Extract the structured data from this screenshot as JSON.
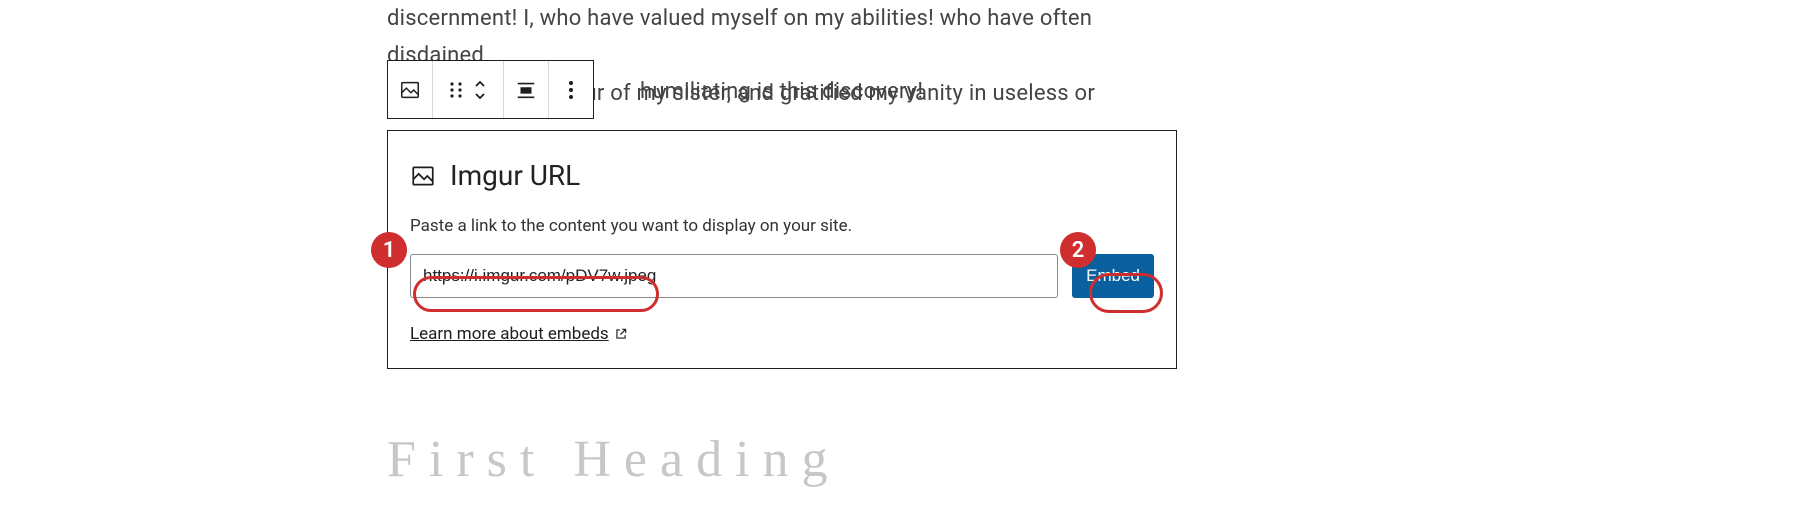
{
  "prose": {
    "line1": "discernment! I, who have valued myself on my abilities! who have often disdained",
    "line2": "the generous candour of my sister, and gratified my vanity in useless or",
    "line3_after_toolbar": "humiliating is this discovery!"
  },
  "toolbar": {
    "block_type_icon": "image-icon",
    "drag_icon": "drag-handle-icon",
    "move_icon": "move-up-down-icon",
    "align_icon": "align-center-icon",
    "more_icon": "more-options-icon"
  },
  "embed_block": {
    "title": "Imgur URL",
    "help": "Paste a link to the content you want to display on your site.",
    "url_value": "https://i.imgur.com/pDV7w.jpeg",
    "embed_label": "Embed",
    "learn_label": "Learn more about embeds",
    "external_icon": "external-link-icon"
  },
  "placeholder_heading": "First Heading",
  "annotations": {
    "one": "1",
    "two": "2"
  },
  "colors": {
    "accent": "#0a5f9e",
    "annotation": "#cf2e2e"
  }
}
